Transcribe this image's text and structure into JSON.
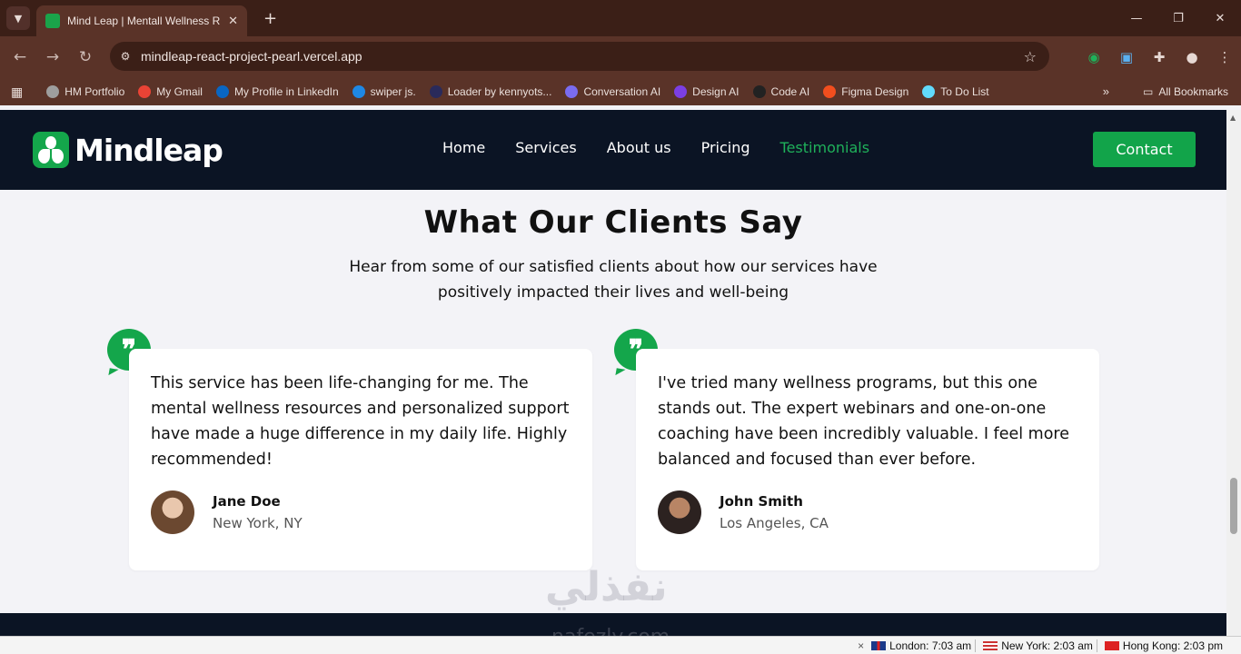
{
  "browser": {
    "tab_title": "Mind Leap | Mentall Wellness R",
    "url": "mindleap-react-project-pearl.vercel.app",
    "bookmarks": [
      {
        "label": "HM Portfolio",
        "color": "#9e9e9e"
      },
      {
        "label": "My Gmail",
        "color": "#ea4335"
      },
      {
        "label": "My Profile in LinkedIn",
        "color": "#0a66c2"
      },
      {
        "label": "swiper js.",
        "color": "#1e88e5"
      },
      {
        "label": "Loader by kennyots...",
        "color": "#2a2a5a"
      },
      {
        "label": "Conversation AI",
        "color": "#7a6cf0"
      },
      {
        "label": "Design AI",
        "color": "#7b3fe4"
      },
      {
        "label": "Code AI",
        "color": "#222222"
      },
      {
        "label": "Figma Design",
        "color": "#f24e1e"
      },
      {
        "label": "To Do List",
        "color": "#61dafb"
      }
    ],
    "all_bookmarks": "All Bookmarks"
  },
  "site": {
    "logo_text": "Mindleap",
    "nav": [
      {
        "label": "Home",
        "active": false
      },
      {
        "label": "Services",
        "active": false
      },
      {
        "label": "About us",
        "active": false
      },
      {
        "label": "Pricing",
        "active": false
      },
      {
        "label": "Testimonials",
        "active": true
      }
    ],
    "contact_label": "Contact",
    "accent": "#14a64b"
  },
  "testimonials": {
    "title": "What Our Clients Say",
    "subtitle": "Hear from some of our satisfied clients about how our services have positively impacted their lives and well-being",
    "items": [
      {
        "text": "This service has been life-changing for me. The mental wellness resources and personalized support have made a huge difference in my daily life. Highly recommended!",
        "name": "Jane Doe",
        "location": "New York, NY"
      },
      {
        "text": "I've tried many wellness programs, but this one stands out. The expert webinars and one-on-one coaching have been incredibly valuable. I feel more balanced and focused than ever before.",
        "name": "John Smith",
        "location": "Los Angeles, CA"
      }
    ]
  },
  "watermark": {
    "arabic": "نفذلي",
    "latin": "nafezly.com"
  },
  "taskbar": {
    "clocks": [
      "London: 7:03 am",
      "New York: 2:03 am",
      "Hong Kong: 2:03 pm"
    ]
  }
}
